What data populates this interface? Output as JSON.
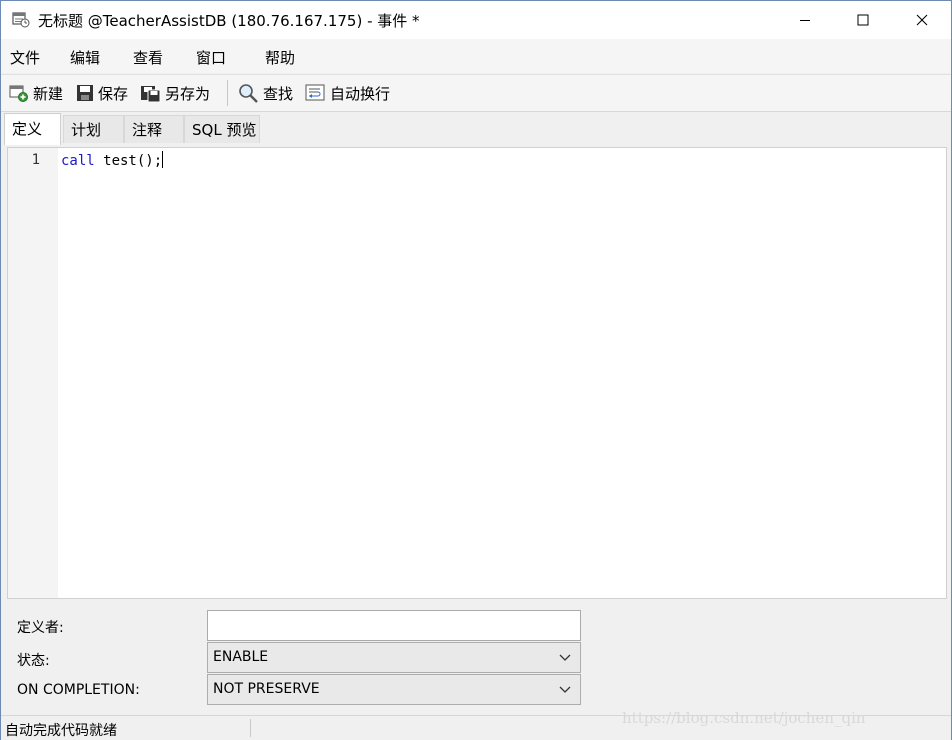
{
  "window": {
    "title": "无标题 @TeacherAssistDB (180.76.167.175) - 事件 *",
    "minimize_label": "—",
    "maximize_label": "☐",
    "close_label": "✕"
  },
  "menu": [
    "文件",
    "编辑",
    "查看",
    "窗口",
    "帮助"
  ],
  "toolbar": {
    "new_label": "新建",
    "save_label": "保存",
    "save_as_label": "另存为",
    "find_label": "查找",
    "word_wrap_label": "自动换行"
  },
  "tabs": [
    "定义",
    "计划",
    "注释",
    "SQL 预览"
  ],
  "editor": {
    "line_number": "1",
    "keyword": "call",
    "code": " test();"
  },
  "form": {
    "definer_label": "定义者:",
    "definer_value": "",
    "status_label": "状态:",
    "status_value": "ENABLE",
    "on_completion_label": "ON COMPLETION:",
    "on_completion_value": "NOT PRESERVE"
  },
  "statusbar": {
    "text": "自动完成代码就绪"
  },
  "watermark": "https://blog.csdn.net/jochen_qin",
  "icons": [
    "app-icon",
    "new-icon",
    "save-icon",
    "save-as-icon",
    "search-icon",
    "word-wrap-icon",
    "chevron-down-icon"
  ]
}
